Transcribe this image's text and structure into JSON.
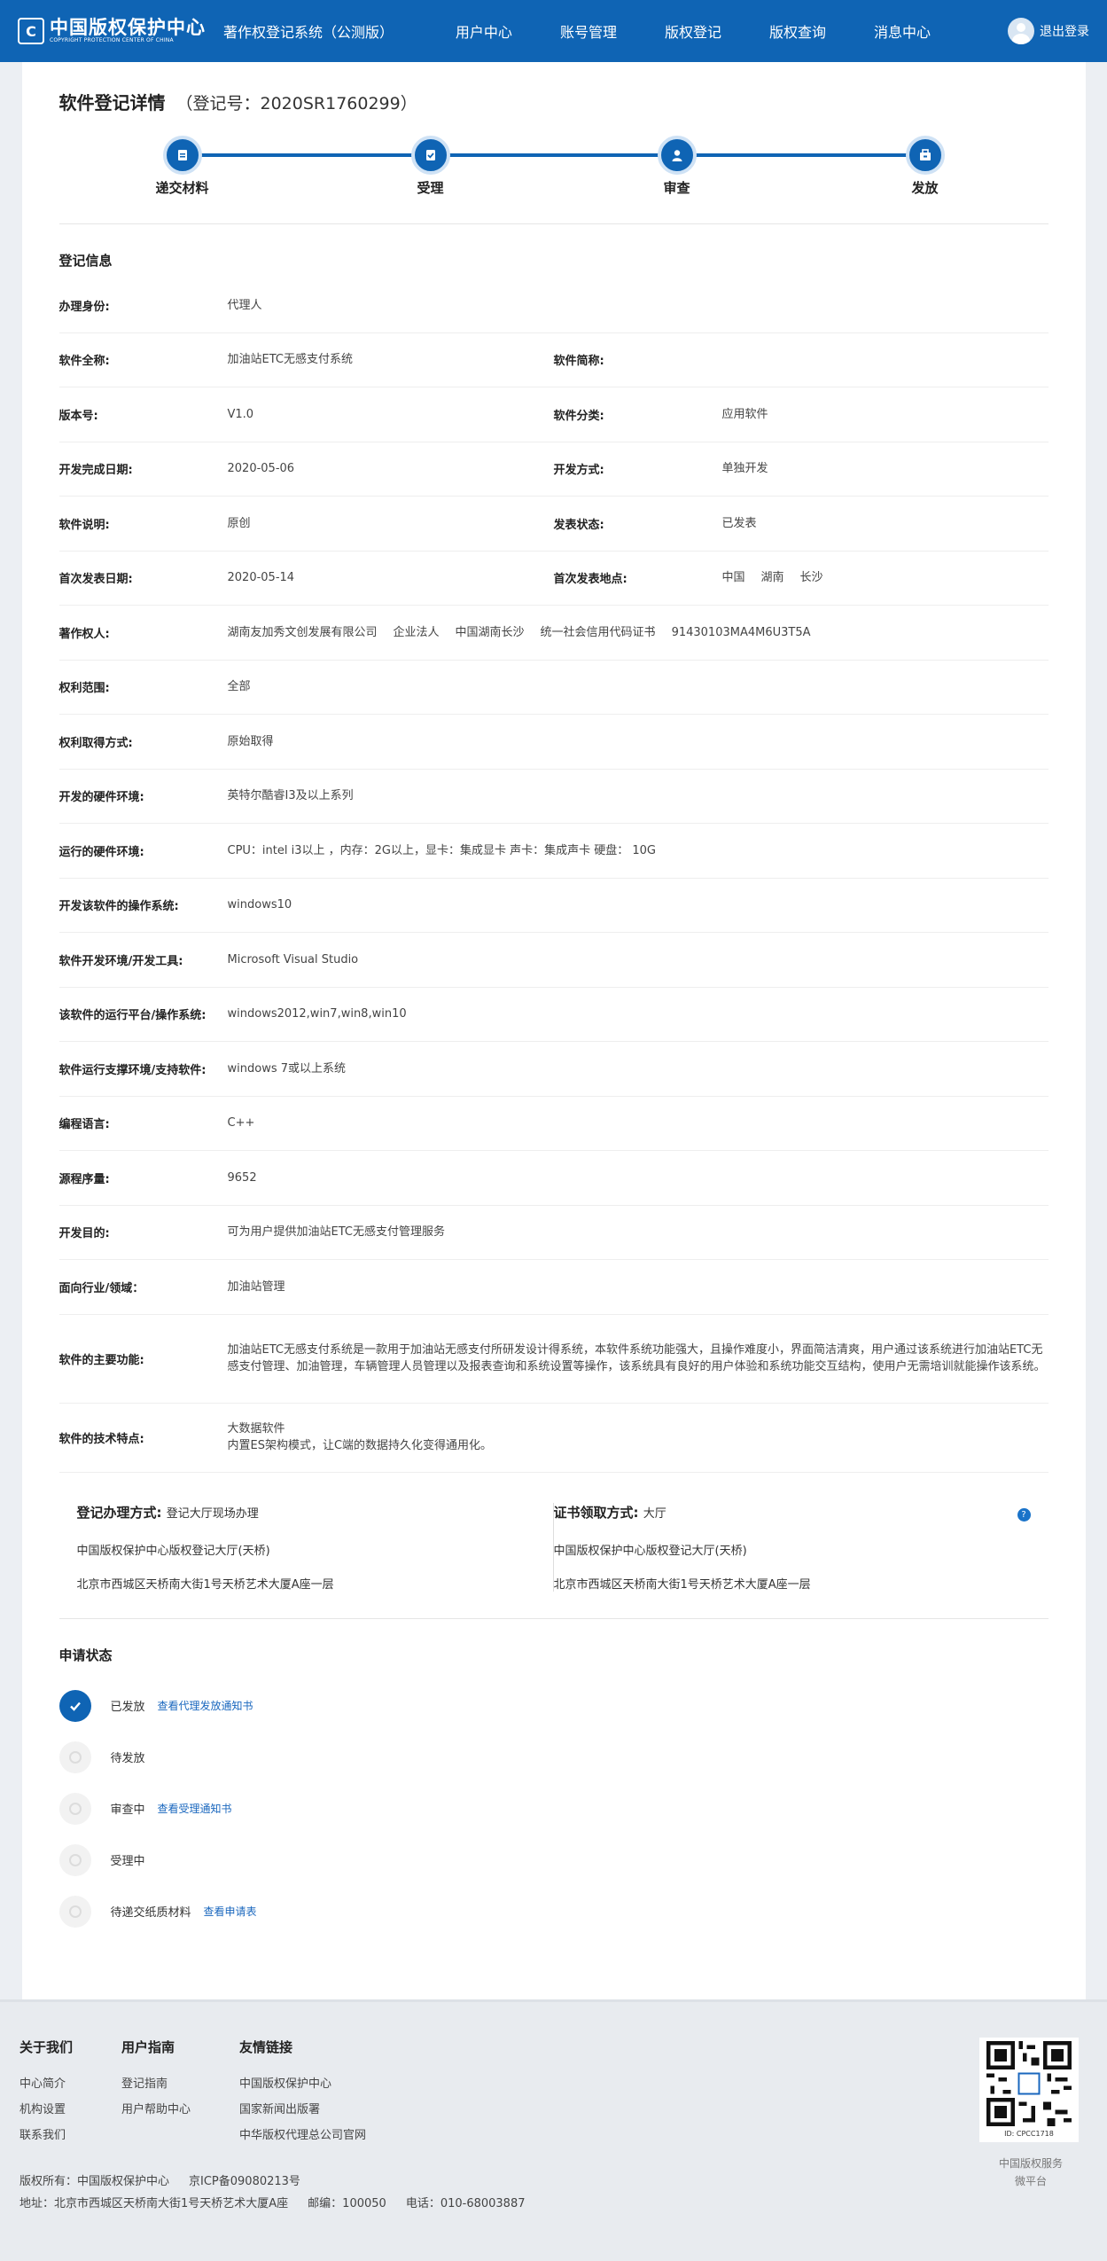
{
  "header": {
    "logo_mark": "C",
    "logo_cn": "中国版权保护中心",
    "logo_en": "COPYRIGHT PROTECTION CENTER OF CHINA",
    "system_title": "著作权登记系统（公测版）",
    "nav": [
      "用户中心",
      "账号管理",
      "版权登记",
      "版权查询",
      "消息中心"
    ],
    "logout": "退出登录"
  },
  "page": {
    "title": "软件登记详情",
    "reg_no": "（登记号：2020SR1760299）"
  },
  "steps": [
    "递交材料",
    "受理",
    "审查",
    "发放"
  ],
  "info": {
    "section_title": "登记信息",
    "rows": [
      {
        "label": "办理身份:",
        "value": "代理人"
      },
      {
        "label": "软件全称:",
        "value": "加油站ETC无感支付系统",
        "label2": "软件简称:",
        "value2": ""
      },
      {
        "label": "版本号:",
        "value": "V1.0",
        "label2": "软件分类:",
        "value2": "应用软件"
      },
      {
        "label": "开发完成日期:",
        "value": "2020-05-06",
        "label2": "开发方式:",
        "value2": "单独开发"
      },
      {
        "label": "软件说明:",
        "value": "原创",
        "label2": "发表状态:",
        "value2": "已发表"
      },
      {
        "label": "首次发表日期:",
        "value": "2020-05-14",
        "label2": "首次发表地点:",
        "value2": [
          "中国",
          "湖南",
          "长沙"
        ]
      },
      {
        "label": "著作权人:",
        "value": [
          "湖南友加秀文创发展有限公司",
          "企业法人",
          "中国湖南长沙",
          "统一社会信用代码证书",
          "91430103MA4M6U3T5A"
        ]
      },
      {
        "label": "权利范围:",
        "value": "全部"
      },
      {
        "label": "权利取得方式:",
        "value": "原始取得"
      },
      {
        "label": "开发的硬件环境:",
        "value": "英特尔酷睿I3及以上系列"
      },
      {
        "label": "运行的硬件环境:",
        "value": "CPU：intel i3以上 ，内存：2G以上，显卡：集成显卡 声卡：集成声卡 硬盘： 10G"
      },
      {
        "label": "开发该软件的操作系统:",
        "value": "windows10"
      },
      {
        "label": "软件开发环境/开发工具:",
        "value": "Microsoft Visual Studio"
      },
      {
        "label": "该软件的运行平台/操作系统:",
        "value": "windows2012,win7,win8,win10"
      },
      {
        "label": "软件运行支撑环境/支持软件:",
        "value": "windows 7或以上系统"
      },
      {
        "label": "编程语言:",
        "value": "C++"
      },
      {
        "label": "源程序量:",
        "value": "9652"
      },
      {
        "label": "开发目的:",
        "value": "可为用户提供加油站ETC无感支付管理服务"
      },
      {
        "label": "面向行业/领域：",
        "value": "加油站管理"
      },
      {
        "label": "软件的主要功能:",
        "value": "加油站ETC无感支付系统是一款用于加油站无感支付所研发设计得系统，本软件系统功能强大，且操作难度小，界面简洁清爽，用户通过该系统进行加油站ETC无感支付管理、加油管理，车辆管理人员管理以及报表查询和系统设置等操作，该系统具有良好的用户体验和系统功能交互结构，使用户无需培训就能操作该系统。"
      },
      {
        "label": "软件的技术特点:",
        "value_lines": [
          "大数据软件",
          "内置ES架构模式，让C端的数据持久化变得通用化。"
        ]
      }
    ]
  },
  "handle": {
    "left_head": "登记办理方式:",
    "left_value": "登记大厅现场办理",
    "left_line1": "中国版权保护中心版权登记大厅(天桥)",
    "left_line2": "北京市西城区天桥南大街1号天桥艺术大厦A座一层",
    "right_head": "证书领取方式:",
    "right_value": "大厅",
    "right_line1": "中国版权保护中心版权登记大厅(天桥)",
    "right_line2": "北京市西城区天桥南大街1号天桥艺术大厦A座一层",
    "help": "?"
  },
  "status": {
    "title": "申请状态",
    "items": [
      {
        "label": "已发放",
        "link": "查看代理发放通知书",
        "done": true
      },
      {
        "label": "待发放",
        "link": ""
      },
      {
        "label": "审查中",
        "link": "查看受理通知书"
      },
      {
        "label": "受理中",
        "link": ""
      },
      {
        "label": "待递交纸质材料",
        "link": "查看申请表"
      }
    ]
  },
  "footer": {
    "cols": [
      {
        "title": "关于我们",
        "links": [
          "中心简介",
          "机构设置",
          "联系我们"
        ]
      },
      {
        "title": "用户指南",
        "links": [
          "登记指南",
          "用户帮助中心"
        ]
      },
      {
        "title": "友情链接",
        "links": [
          "中国版权保护中心",
          "国家新闻出版署",
          "中华版权代理总公司官网"
        ]
      }
    ],
    "copyright": "版权所有：中国版权保护中心",
    "icp": "京ICP备09080213号",
    "address": "地址：北京市西城区天桥南大街1号天桥艺术大厦A座",
    "postcode": "邮编：100050",
    "phone": "电话：010-68003887",
    "qr_id": "ID: CPCC1718",
    "qr_label1": "中国版权服务",
    "qr_label2": "微平台"
  }
}
